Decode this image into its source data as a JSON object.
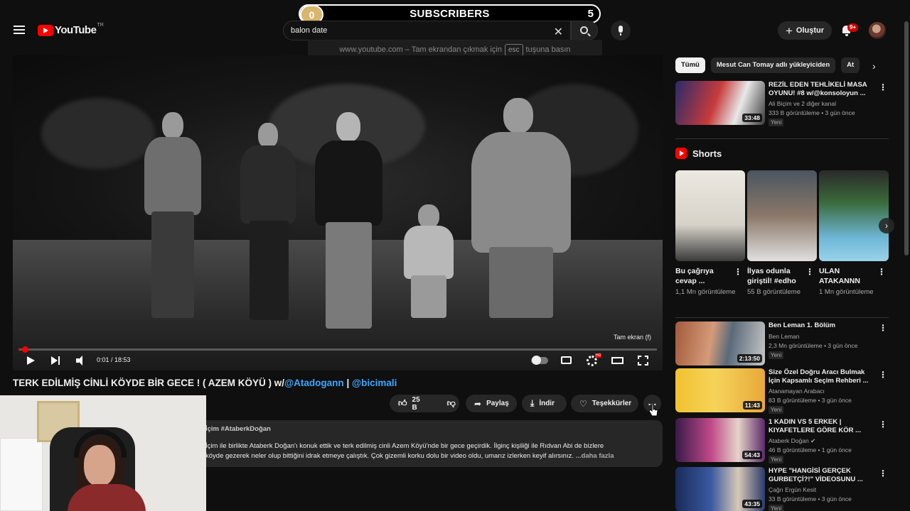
{
  "overlay": {
    "left_value": "0",
    "title": "SUBSCRIBERS",
    "right_value": "5"
  },
  "header": {
    "logo_text": "YouTube",
    "logo_region": "TR",
    "search_value": "balon date",
    "create_label": "Oluştur",
    "notification_badge": "9+"
  },
  "esc_banner": {
    "prefix": "www.youtube.com – Tam ekrandan çıkmak için",
    "key": "esc",
    "suffix": "tuşuna basın"
  },
  "player": {
    "fullscreen_hint": "Tam ekran (f)",
    "time": "0:01 / 18:53",
    "progress": 0.001
  },
  "video": {
    "title_prefix": "TERK EDİLMİŞ CİNLİ KÖYDE BİR GECE ! ( AZEM KÖYÜ ) w/",
    "mention1": "@Atadogann",
    "separator": " | ",
    "mention2": "@bicimali",
    "likes": "25 B",
    "share_label": "Paylaş",
    "download_label": "İndir",
    "thanks_label": "Teşekkürler",
    "more_label": "..."
  },
  "description": {
    "tags": "İçim #AtaberkDoğan",
    "line1": "İçim ile birlikte Ataberk Doğan'ı konuk ettik ve terk edilmiş cinli Azem Köyü'nde bir gece geçirdik. İlginç kişiliği ile Rıdvan Abi de bizlere",
    "line2": "köyde gezerek neler olup bittiğini idrak etmeye çalıştık. Çok gizemli korku dolu bir video oldu, umarız izlerken keyif alırsınız.",
    "more": "...daha fazla"
  },
  "sidebar": {
    "chips": [
      "Tümü",
      "Mesut Can Tomay adlı yükleyiciden",
      "At"
    ],
    "top_video": {
      "title": "REZİL EDEN TEHLİKELİ MASA OYUNU! #8 w/@konsoloyun ...",
      "channel": "Ali Biçim ve 2 diğer kanal",
      "meta": "333 B görüntüleme • 3 gün önce",
      "badge": "Yeni",
      "duration": "33:48"
    },
    "shorts_label": "Shorts",
    "shorts": [
      {
        "title": "Bu çağrıya cevap ...",
        "views": "1,1 Mn görüntüleme"
      },
      {
        "title": "İlyas odunla giriştiİ! #edho",
        "views": "55 B görüntüleme"
      },
      {
        "title": "ULAN ATAKANNN",
        "views": "1 Mn görüntüleme"
      }
    ],
    "videos": [
      {
        "title": "Ben Leman 1. Bölüm",
        "channel": "Ben Leman",
        "meta": "2,3 Mn görüntüleme • 3 gün önce",
        "badge": "Yeni",
        "duration": "2:13:50"
      },
      {
        "title": "Size Özel Doğru Aracı Bulmak İçin Kapsamlı Seçim Rehberi ...",
        "channel": "Atanamayan Arabacı",
        "meta": "83 B görüntüleme • 3 gün önce",
        "badge": "Yeni",
        "duration": "11:43"
      },
      {
        "title": "1 KADIN VS 5 ERKEK | KIYAFETLERE GÖRE KÖR ...",
        "channel": "Ataberk Doğan ✔",
        "meta": "46 B görüntüleme • 1 gün önce",
        "badge": "Yeni",
        "duration": "54:43"
      },
      {
        "title": "HYPE \"HANGİSİ GERÇEK GURBETÇİ?!\" VİDEOSUNU ...",
        "channel": "Çağrı Ergün Kesit",
        "meta": "33 B görüntüleme • 3 gün önce",
        "badge": "Yeni",
        "duration": "43:35"
      }
    ]
  },
  "colors": {
    "accent_red": "#ff0000",
    "link_blue": "#3ea6ff",
    "background": "#0f0f0f"
  },
  "icons": [
    "menu-icon",
    "youtube-logo-icon",
    "search-icon",
    "mic-icon",
    "plus-icon",
    "bell-icon",
    "play-icon",
    "next-icon",
    "volume-icon",
    "captions-icon",
    "settings-icon",
    "theater-icon",
    "fullscreen-icon",
    "like-icon",
    "dislike-icon",
    "share-icon",
    "download-icon",
    "thanks-icon",
    "more-icon",
    "shorts-icon",
    "chevron-right-icon"
  ]
}
